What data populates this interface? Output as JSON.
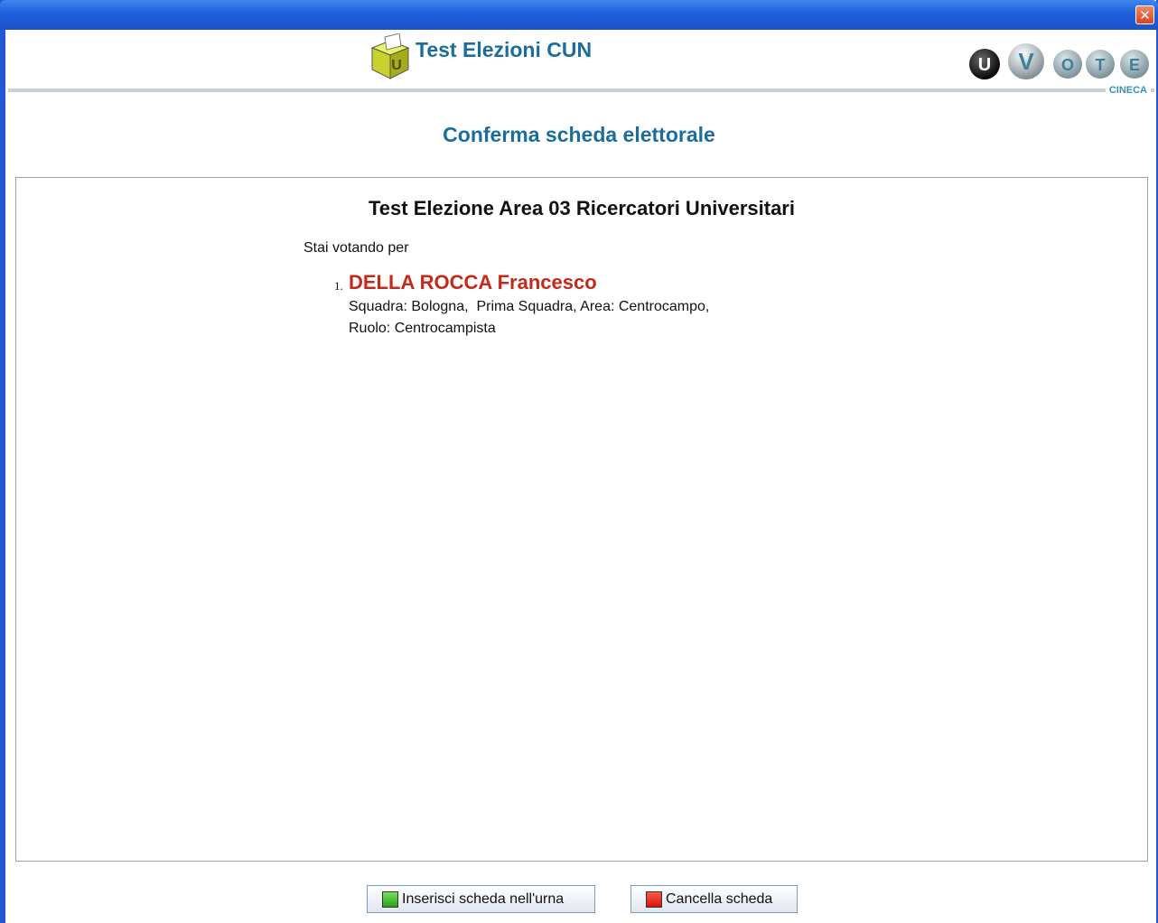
{
  "window": {
    "close_glyph": "✕"
  },
  "header": {
    "app_title": "Test Elezioni CUN",
    "app_logo_icon": "ballot-box-icon",
    "brand_letters": [
      "U",
      "V",
      "O",
      "T",
      "E"
    ],
    "brand_sub": "CINECA"
  },
  "page_title": "Conferma scheda elettorale",
  "ballot": {
    "election_title": "Test Elezione Area 03 Ricercatori Universitari",
    "voting_label": "Stai votando per",
    "candidates": [
      {
        "number": "1.",
        "name": "DELLA ROCCA Francesco",
        "detail_line1": "Squadra: Bologna,  Prima Squadra, Area: Centrocampo,",
        "detail_line2": "Ruolo: Centrocampista"
      }
    ]
  },
  "actions": {
    "confirm_label": "Inserisci scheda nell'urna",
    "cancel_label": "Cancella scheda"
  },
  "colors": {
    "accent": "#1a6d9c",
    "candidate_name": "#c4291a",
    "titlebar": "#1e5fdc"
  }
}
